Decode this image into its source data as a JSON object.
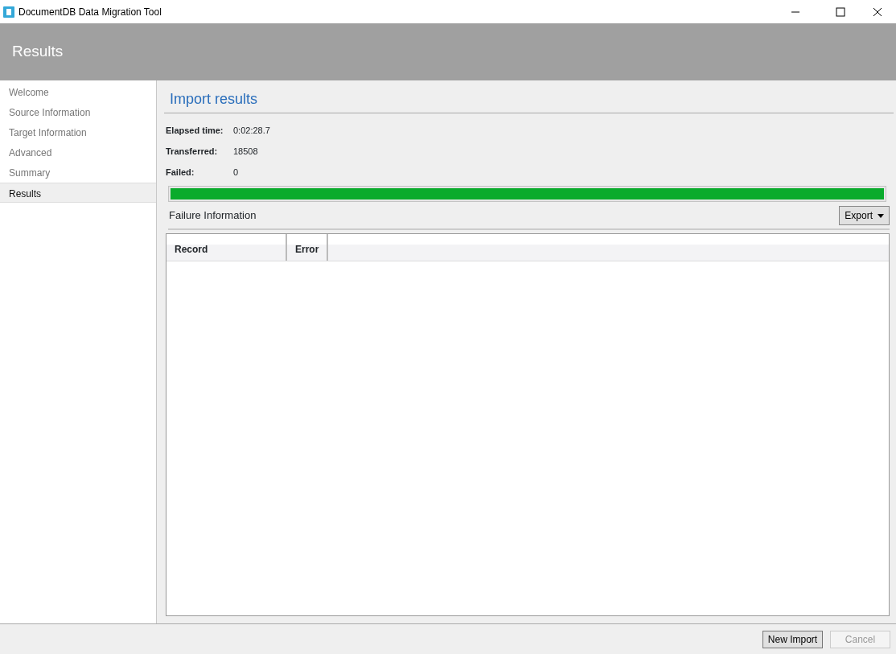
{
  "window": {
    "title": "DocumentDB Data Migration Tool"
  },
  "header": {
    "title": "Results"
  },
  "sidebar": {
    "items": [
      {
        "label": "Welcome",
        "selected": false
      },
      {
        "label": "Source Information",
        "selected": false
      },
      {
        "label": "Target Information",
        "selected": false
      },
      {
        "label": "Advanced",
        "selected": false
      },
      {
        "label": "Summary",
        "selected": false
      },
      {
        "label": "Results",
        "selected": true
      }
    ]
  },
  "main": {
    "title": "Import results",
    "stats": [
      {
        "label": "Elapsed time:",
        "value": "0:02:28.7"
      },
      {
        "label": "Transferred:",
        "value": "18508"
      },
      {
        "label": "Failed:",
        "value": "0"
      }
    ],
    "progress": {
      "level": 1.0
    },
    "failure": {
      "title": "Failure Information",
      "export_button": "Export",
      "table": {
        "columns": [
          "Record",
          "Error"
        ]
      }
    }
  },
  "footer": {
    "buttons": [
      {
        "label": "New Import",
        "disabled": false
      },
      {
        "label": "Cancel",
        "disabled": true
      }
    ]
  }
}
